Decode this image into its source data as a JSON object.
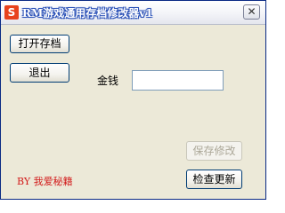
{
  "window": {
    "title": "RM游戏通用存档修改器v1",
    "icon_glyph": "S",
    "close_glyph": "✕"
  },
  "buttons": {
    "open_save": "打开存档",
    "exit": "退出",
    "save_changes": "保存修改",
    "check_update": "检查更新"
  },
  "fields": {
    "money_label": "金钱",
    "money_value": ""
  },
  "credit": "BY 我爱秘籍",
  "colors": {
    "title_bar_border": "#0a2a84",
    "dialog_background": "#ece9d8",
    "button_border": "#003c74",
    "credit_text": "#d21b1b",
    "icon_background": "#e8421c"
  }
}
